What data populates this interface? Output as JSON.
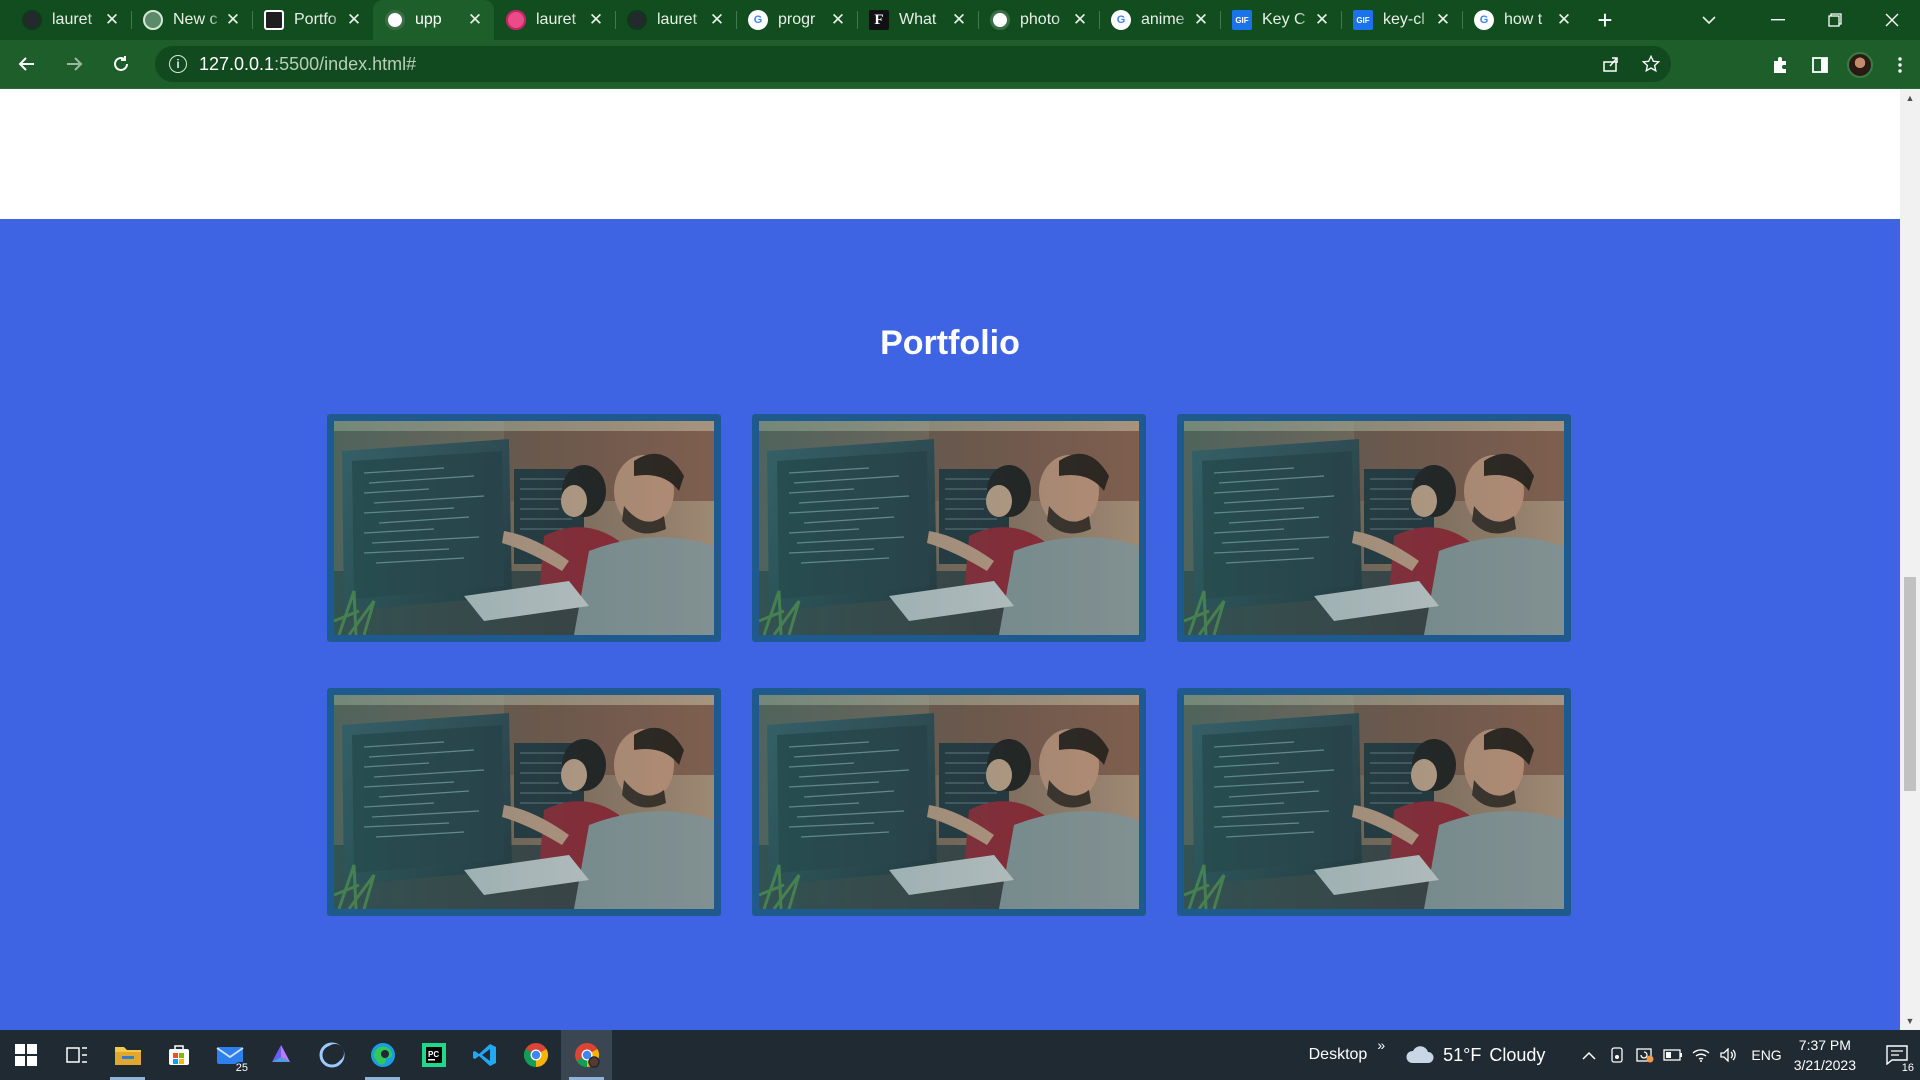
{
  "browser": {
    "tabs": [
      {
        "title": "lauret",
        "favicon": "github-icon",
        "color": "#24292e",
        "active": false
      },
      {
        "title": "New c",
        "favicon": "openai-icon",
        "color": "#5a8a6a",
        "active": false
      },
      {
        "title": "Portfo",
        "favicon": "codepen-icon",
        "color": "#1e1e1e",
        "active": false
      },
      {
        "title": "upp",
        "favicon": "globe-icon",
        "color": "#3c6e46",
        "active": true
      },
      {
        "title": "lauret",
        "favicon": "dribbble-icon",
        "color": "#ea4c89",
        "active": false
      },
      {
        "title": "lauret",
        "favicon": "github-icon",
        "color": "#24292e",
        "active": false
      },
      {
        "title": "progr",
        "favicon": "google-icon",
        "color": "#ffffff",
        "active": false
      },
      {
        "title": "What",
        "favicon": "f-letter-icon",
        "color": "#111111",
        "active": false
      },
      {
        "title": "photo",
        "favicon": "globe-icon",
        "color": "#3c6e46",
        "active": false
      },
      {
        "title": "anime",
        "favicon": "google-icon",
        "color": "#ffffff",
        "active": false
      },
      {
        "title": "Key C",
        "favicon": "gif-icon",
        "color": "#1a73e8",
        "active": false
      },
      {
        "title": "key-cl",
        "favicon": "gif-icon",
        "color": "#1a73e8",
        "active": false
      },
      {
        "title": "how t",
        "favicon": "google-icon",
        "color": "#ffffff",
        "active": false
      }
    ],
    "favicon_letters": {
      "f": "F",
      "gif": "GIF",
      "g": "G"
    },
    "new_tab_symbol": "+",
    "close_symbol": "✕",
    "url_host": "127.0.0.1",
    "url_path": ":5500/index.html#"
  },
  "page": {
    "section_title": "Portfolio",
    "portfolio_items": 6,
    "bg_color": "#3e63e3",
    "card_border_color": "#1f5a8f"
  },
  "taskbar": {
    "mail_badge": "25",
    "desktop_label": "Desktop",
    "overflow_symbol": "»",
    "temperature": "51°F",
    "weather": "Cloudy",
    "language": "ENG",
    "time": "7:37 PM",
    "date": "3/21/2023",
    "notifications": "16"
  }
}
